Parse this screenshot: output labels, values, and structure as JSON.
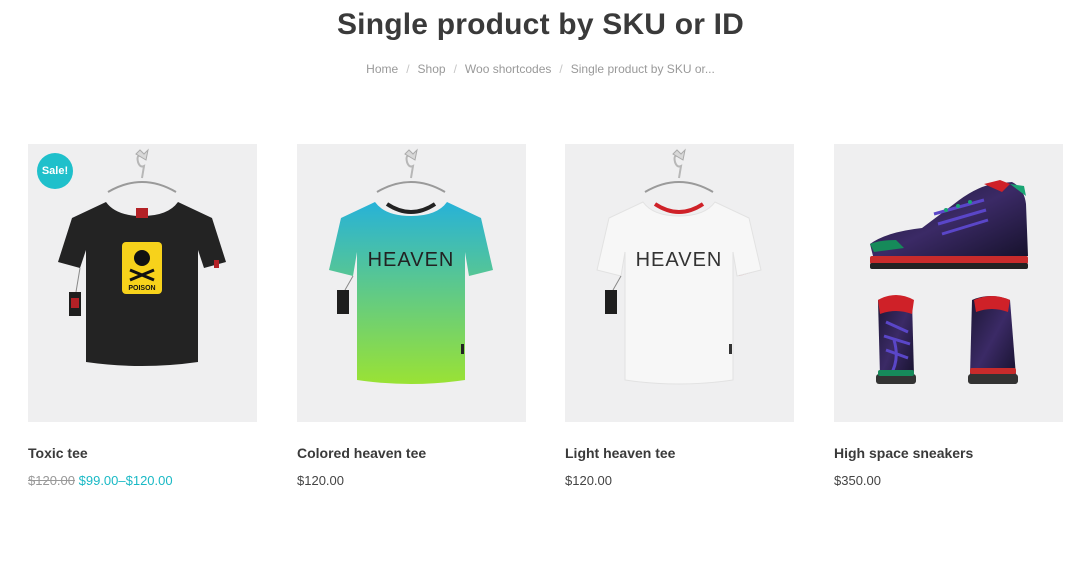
{
  "page": {
    "title": "Single product by SKU or ID"
  },
  "breadcrumb": {
    "items": [
      "Home",
      "Shop",
      "Woo shortcodes"
    ],
    "current": "Single product by SKU or...",
    "separator": "/"
  },
  "products": [
    {
      "name": "Toxic tee",
      "badge": "Sale!",
      "price_regular": "$120.00",
      "price_sale": "$99.00–$120.00",
      "tee_color": "#232323",
      "print_text": "POISON",
      "icon": "tshirt-image"
    },
    {
      "name": "Colored heaven tee",
      "price": "$120.00",
      "print_text": "HEAVEN",
      "gradient_top": "#27b2d8",
      "gradient_bottom": "#9ae234",
      "icon": "tshirt-image"
    },
    {
      "name": "Light heaven tee",
      "price": "$120.00",
      "print_text": "HEAVEN",
      "tee_color": "#f2f2f2",
      "accent": "#cf2128",
      "icon": "tshirt-image"
    },
    {
      "name": "High space sneakers",
      "price": "$350.00",
      "icon": "sneaker-image"
    }
  ],
  "colors": {
    "accent": "#1fc0cb",
    "thumb_bg": "#efeff0"
  }
}
